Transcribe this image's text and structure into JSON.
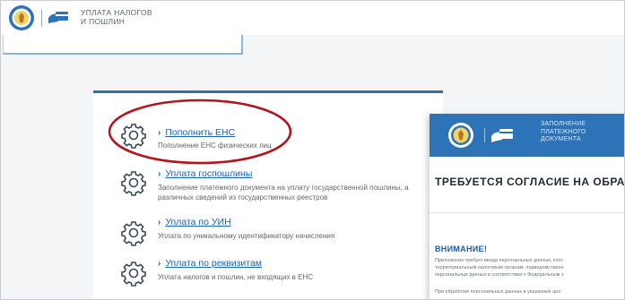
{
  "header": {
    "title_line1": "УПЛАТА НАЛОГОВ",
    "title_line2": "И ПОШЛИН"
  },
  "services": [
    {
      "label": "Пополнить ЕНС",
      "description": "Пополнение ЕНС физических лиц"
    },
    {
      "label": "Уплата госпошлины",
      "description_line1": "Заполнение платежного документа на уплату государственной пошлины, а",
      "description_line2": "различных сведений из государственных реестров"
    },
    {
      "label": "Уплата по УИН",
      "description": "Уплата по уникальному идентификатору начисления"
    },
    {
      "label": "Уплата по реквизитам",
      "description": "Уплата налогов и пошлин, не входящих в ЕНС"
    }
  ],
  "popup": {
    "app_line1": "ЗАПОЛНЕНИЕ",
    "app_line2": "ПЛАТЕЖНОГО",
    "app_line3": "ДОКУМЕНТА",
    "title": "ТРЕБУЕТСЯ СОГЛАСИЕ НА ОБРА",
    "warning": "ВНИМАНИЕ!",
    "text_line1": "Приложение требует ввода персональных данных, кото",
    "text_line2": "территориальным налоговым органам, подведомственн",
    "text_line3": "персональных данных в соответствии с Федеральным з",
    "text_line4": "При обработке персональных данных в указанных цел"
  },
  "colors": {
    "accent": "#2e6fb0",
    "link": "#1a62b5",
    "highlight_ellipse": "#b0161c",
    "popup_header": "#2d73b8"
  }
}
